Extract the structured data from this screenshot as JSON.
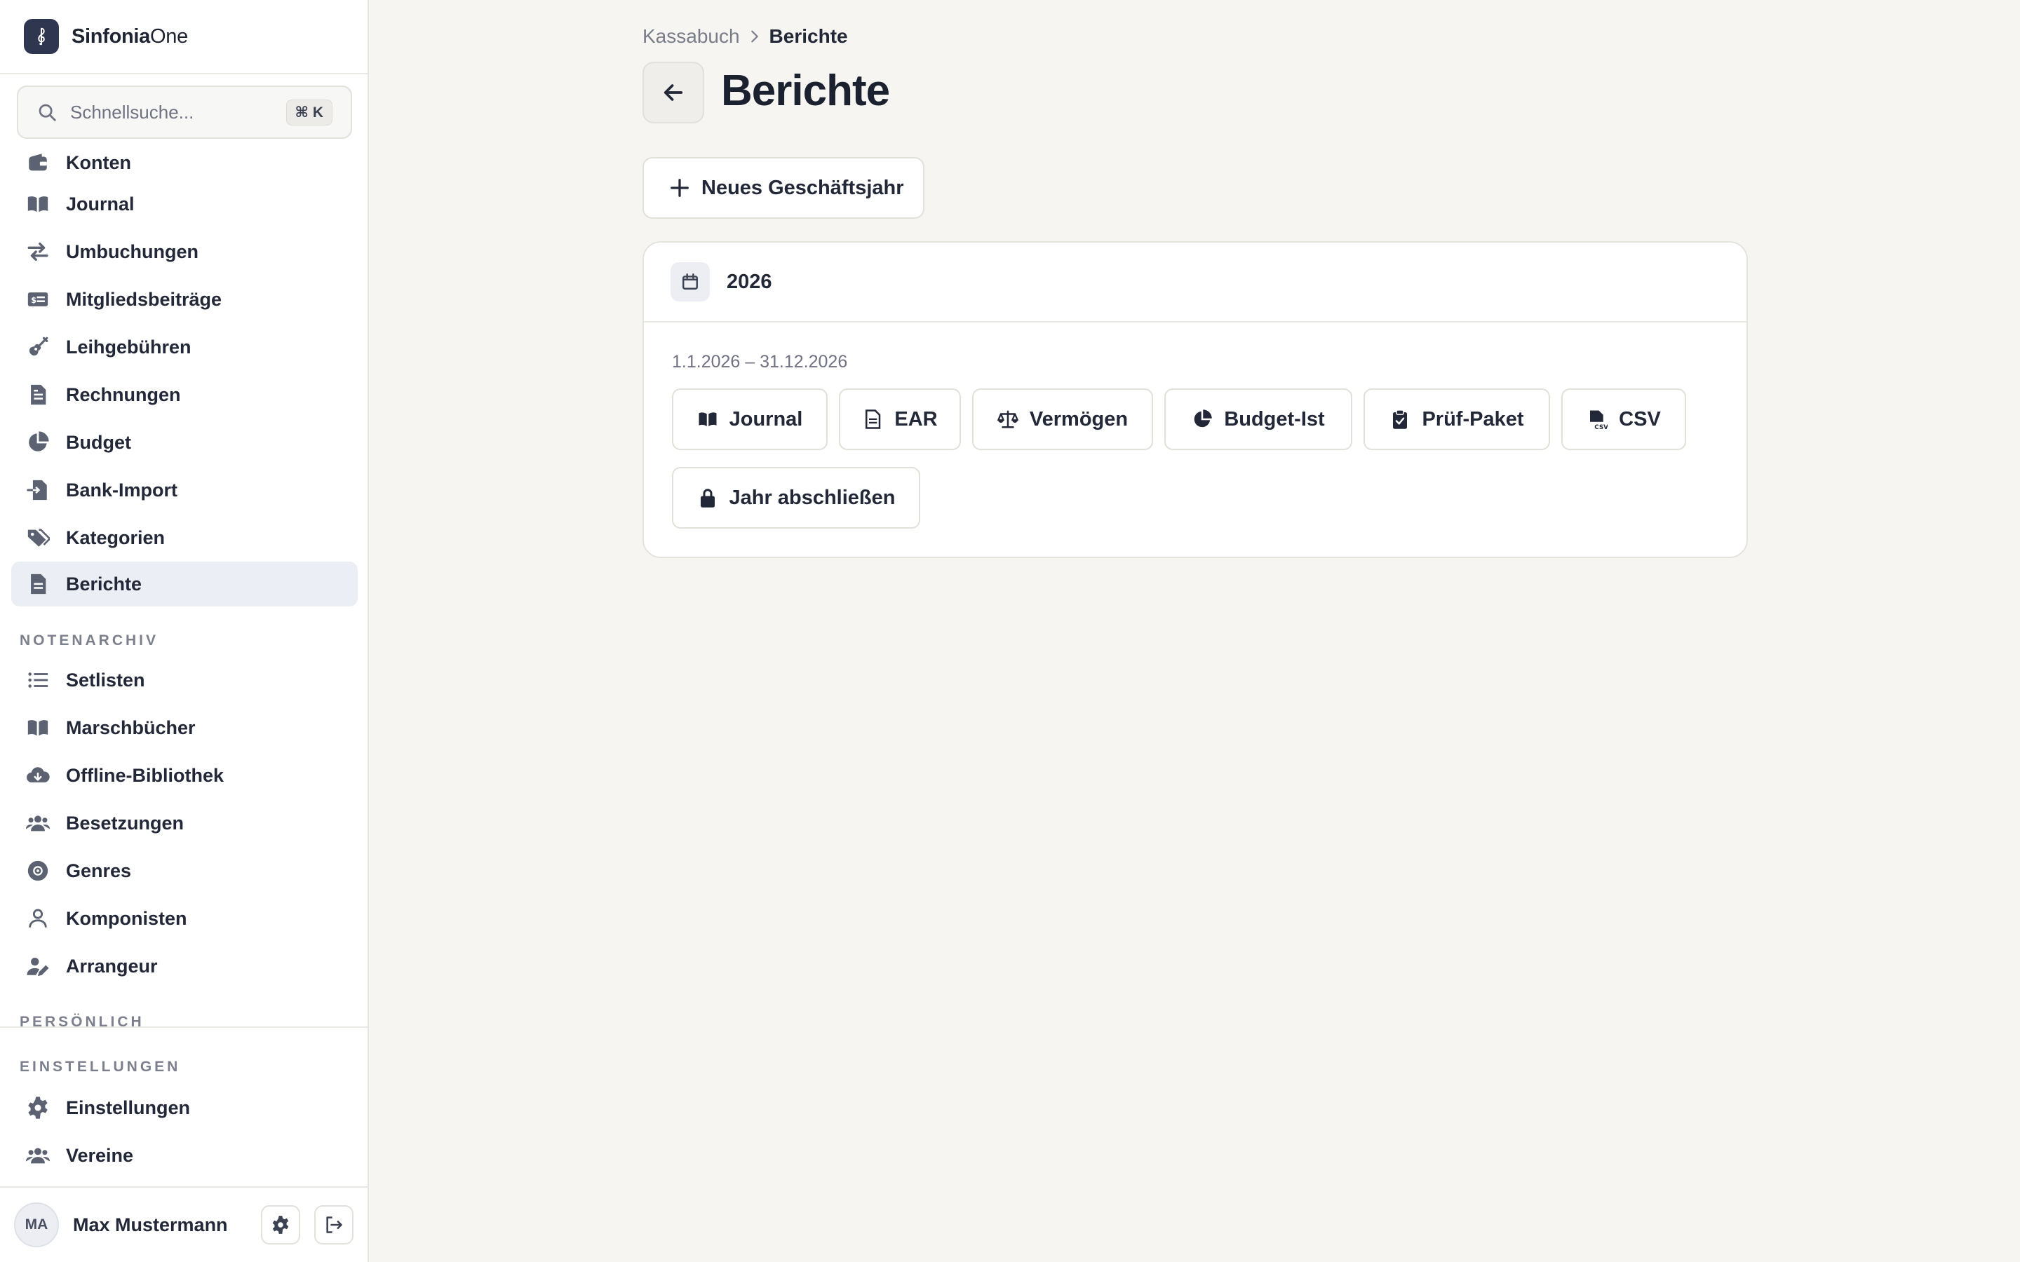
{
  "brand": {
    "name_bold": "Sinfonia",
    "name_light": "One"
  },
  "search": {
    "placeholder": "Schnellsuche...",
    "shortcut": "⌘ K"
  },
  "sidebar": {
    "kassabuch_items": [
      {
        "label": "Konten",
        "icon": "wallet-icon"
      },
      {
        "label": "Journal",
        "icon": "book-open-icon"
      },
      {
        "label": "Umbuchungen",
        "icon": "arrows-right-left-icon"
      },
      {
        "label": "Mitgliedsbeiträge",
        "icon": "money-card-icon"
      },
      {
        "label": "Leihgebühren",
        "icon": "guitar-icon"
      },
      {
        "label": "Rechnungen",
        "icon": "file-invoice-icon"
      },
      {
        "label": "Budget",
        "icon": "pie-chart-icon"
      },
      {
        "label": "Bank-Import",
        "icon": "file-import-icon"
      },
      {
        "label": "Kategorien",
        "icon": "tags-icon"
      },
      {
        "label": "Berichte",
        "icon": "file-text-icon",
        "active": true
      }
    ],
    "notenarchiv_label": "NOTENARCHIV",
    "notenarchiv_items": [
      {
        "label": "Setlisten",
        "icon": "list-icon"
      },
      {
        "label": "Marschbücher",
        "icon": "book-open-icon"
      },
      {
        "label": "Offline-Bibliothek",
        "icon": "cloud-download-icon"
      },
      {
        "label": "Besetzungen",
        "icon": "users-icon"
      },
      {
        "label": "Genres",
        "icon": "record-icon"
      },
      {
        "label": "Komponisten",
        "icon": "user-outline-icon"
      },
      {
        "label": "Arrangeur",
        "icon": "user-edit-icon"
      }
    ],
    "persoenlich_label": "PERSÖNLICH",
    "einstellungen_label": "EINSTELLUNGEN",
    "einstellungen_items": [
      {
        "label": "Einstellungen",
        "icon": "gear-icon"
      },
      {
        "label": "Vereine",
        "icon": "users-icon"
      }
    ]
  },
  "user": {
    "initials": "MA",
    "name": "Max Mustermann"
  },
  "breadcrumb": {
    "parent": "Kassabuch",
    "current": "Berichte"
  },
  "page": {
    "title": "Berichte",
    "new_year_label": "Neues Geschäftsjahr"
  },
  "year_card": {
    "year": "2026",
    "range": "1.1.2026 – 31.12.2026",
    "buttons": [
      {
        "label": "Journal",
        "icon": "book-open-icon"
      },
      {
        "label": "EAR",
        "icon": "file-text-icon"
      },
      {
        "label": "Vermögen",
        "icon": "scale-icon"
      },
      {
        "label": "Budget-Ist",
        "icon": "pie-chart-icon"
      },
      {
        "label": "Prüf-Paket",
        "icon": "clipboard-check-icon"
      },
      {
        "label": "CSV",
        "icon": "file-csv-icon"
      }
    ],
    "close_year_label": "Jahr abschließen"
  },
  "colors": {
    "accent": "#2f3650",
    "active_bg": "#eceef5",
    "page_bg": "#f6f5f2"
  }
}
